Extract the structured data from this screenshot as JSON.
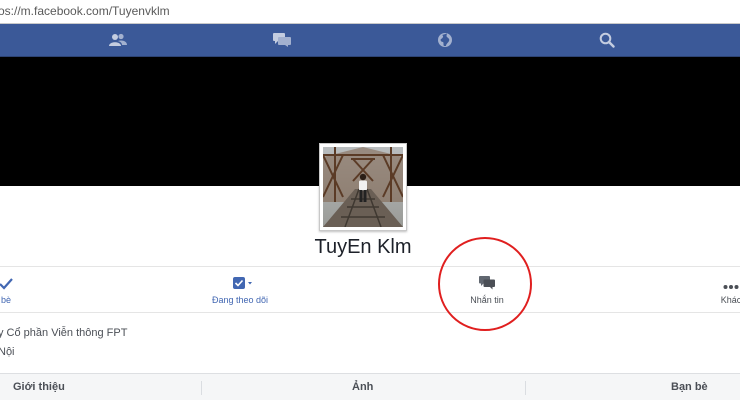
{
  "browser": {
    "url": "os://m.facebook.com/Tuyenvklm"
  },
  "nav": {
    "icons": [
      "friends-icon",
      "messages-icon",
      "globe-icon",
      "search-icon"
    ],
    "color": "#3b5998"
  },
  "profile": {
    "name": "TuyEn Klm"
  },
  "actions": {
    "friend_label": "bè",
    "following_label": "Đang theo dõi",
    "message_label": "Nhắn tin",
    "more_label": "Khác"
  },
  "info": {
    "work": "y Cổ phần Viễn thông FPT",
    "location": "Nội"
  },
  "tabs": {
    "about": "Giới thiệu",
    "photos": "Ảnh",
    "friends": "Bạn bè"
  },
  "colors": {
    "accent": "#4267b2",
    "annotation": "#e01f1f"
  }
}
